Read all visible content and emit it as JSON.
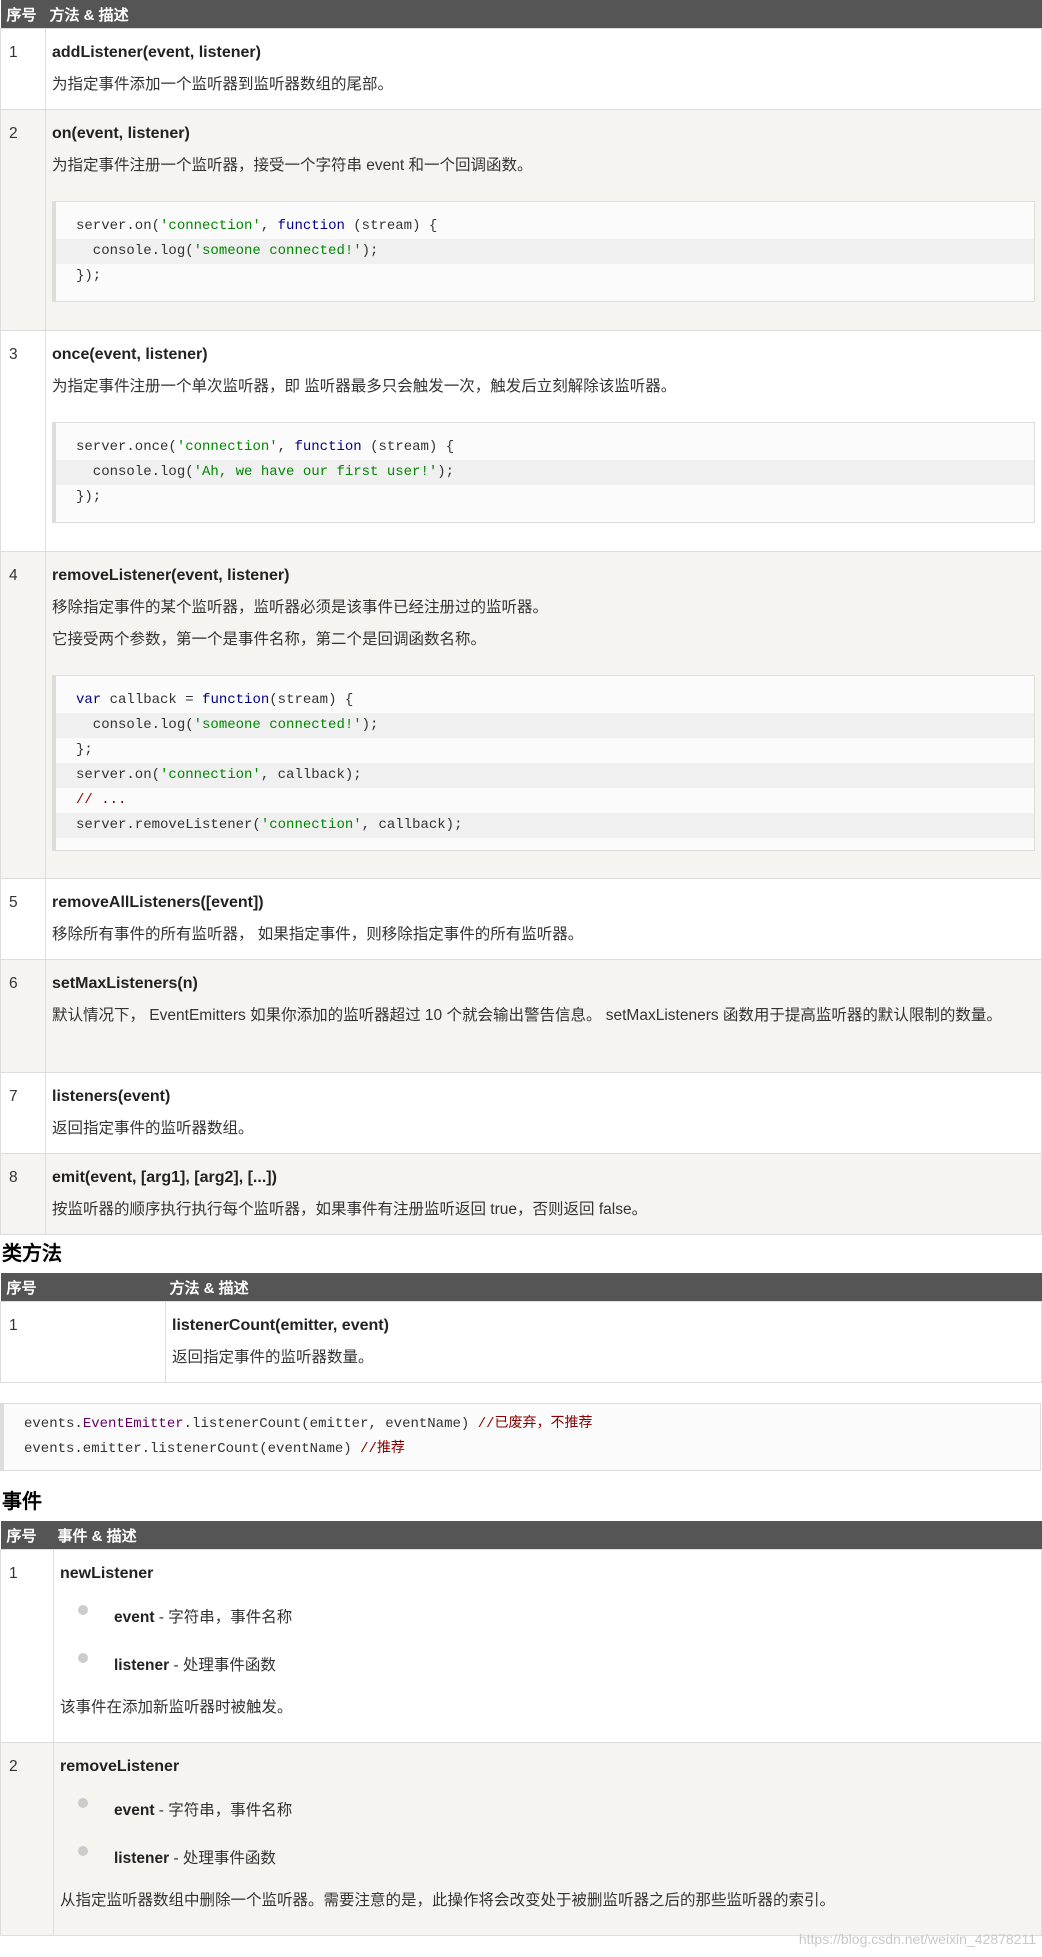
{
  "methods": {
    "headers": [
      "序号",
      "方法 & 描述"
    ],
    "rows": [
      {
        "num": "1",
        "name": "addListener(event, listener)",
        "lines": [
          "为指定事件添加一个监听器到监听器数组的尾部。"
        ]
      },
      {
        "num": "2",
        "name": "on(event, listener)",
        "lines": [
          "为指定事件注册一个监听器，接受一个字符串 event 和一个回调函数。"
        ],
        "code": [
          "server.on('connection', function (stream) {",
          "  console.log('someone connected!');",
          "});"
        ]
      },
      {
        "num": "3",
        "name": "once(event, listener)",
        "lines": [
          "为指定事件注册一个单次监听器，即 监听器最多只会触发一次，触发后立刻解除该监听器。"
        ],
        "code": [
          "server.once('connection', function (stream) {",
          "  console.log('Ah, we have our first user!');",
          "});"
        ]
      },
      {
        "num": "4",
        "name": "removeListener(event, listener)",
        "lines": [
          "移除指定事件的某个监听器，监听器必须是该事件已经注册过的监听器。",
          "它接受两个参数，第一个是事件名称，第二个是回调函数名称。"
        ],
        "code": [
          "var callback = function(stream) {",
          "  console.log('someone connected!');",
          "};",
          "server.on('connection', callback);",
          "// ...",
          "server.removeListener('connection', callback);"
        ]
      },
      {
        "num": "5",
        "name": "removeAllListeners([event])",
        "lines": [
          "移除所有事件的所有监听器， 如果指定事件，则移除指定事件的所有监听器。"
        ]
      },
      {
        "num": "6",
        "name": "setMaxListeners(n)",
        "lines": [
          "默认情况下， EventEmitters 如果你添加的监听器超过 10 个就会输出警告信息。 setMaxListeners 函数用于提高监听器的默认限制的数量。"
        ]
      },
      {
        "num": "7",
        "name": "listeners(event)",
        "lines": [
          "返回指定事件的监听器数组。"
        ]
      },
      {
        "num": "8",
        "name": "emit(event, [arg1], [arg2], [...])",
        "lines": [
          "按监听器的顺序执行执行每个监听器，如果事件有注册监听返回 true，否则返回 false。"
        ]
      }
    ]
  },
  "class_methods": {
    "heading": "类方法",
    "headers": [
      "序号",
      "方法 & 描述"
    ],
    "rows": [
      {
        "num": "1",
        "name": "listenerCount(emitter, event)",
        "lines": [
          "返回指定事件的监听器数量。"
        ]
      }
    ],
    "code": [
      "events.EventEmitter.listenerCount(emitter, eventName) //已废弃，不推荐",
      "events.emitter.listenerCount(eventName) //推荐"
    ]
  },
  "events": {
    "heading": "事件",
    "headers": [
      "序号",
      "事件 & 描述"
    ],
    "rows": [
      {
        "num": "1",
        "name": "newListener",
        "params": [
          {
            "name": "event",
            "desc": " - 字符串，事件名称"
          },
          {
            "name": "listener",
            "desc": " - 处理事件函数"
          }
        ],
        "line": "该事件在添加新监听器时被触发。"
      },
      {
        "num": "2",
        "name": "removeListener",
        "params": [
          {
            "name": "event",
            "desc": " - 字符串，事件名称"
          },
          {
            "name": "listener",
            "desc": " - 处理事件函数"
          }
        ],
        "line": "从指定监听器数组中删除一个监听器。需要注意的是，此操作将会改变处于被删监听器之后的那些监听器的索引。"
      }
    ]
  },
  "watermark": "https://blog.csdn.net/weixin_42878211"
}
